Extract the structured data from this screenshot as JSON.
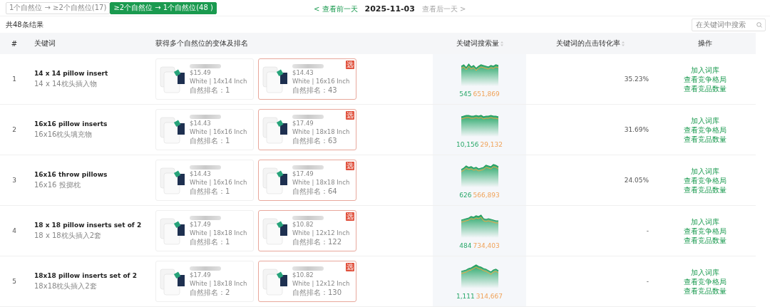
{
  "filter_tabs": [
    {
      "label": "1个自然位 → ≥2个自然位(17)",
      "selected": false
    },
    {
      "label": "≥2个自然位 → 1个自然位(48 )",
      "selected": true
    }
  ],
  "date_nav": {
    "prev": "< 查看前一天",
    "date": "2025-11-03",
    "next": "查看后一天 >",
    "next_disabled": true
  },
  "result_count": "共48条结果",
  "search": {
    "placeholder": "在关键词中搜索"
  },
  "table": {
    "columns": [
      {
        "label": "#",
        "sortable": false
      },
      {
        "label": "关键词",
        "sortable": false
      },
      {
        "label": "获得多个自然位的变体及排名",
        "sortable": false
      },
      {
        "label": "关键词搜索量",
        "sortable": true
      },
      {
        "label": "关键词的点击转化率",
        "sortable": true
      },
      {
        "label": "操作",
        "sortable": false
      }
    ],
    "rows": [
      {
        "index": "1",
        "keyword": "14 x 14 pillow insert",
        "translation": "14 x 14枕头插入物",
        "variants": [
          {
            "price": "$15.49",
            "spec": "White | 14x14 Inch",
            "rank": "自然排名：1",
            "flagged": false
          },
          {
            "price": "$14.43",
            "spec": "White | 16x16 Inch",
            "rank": "自然排名：43",
            "flagged": true,
            "badge": "选"
          }
        ],
        "primary": "545",
        "secondary": "651,869",
        "ctr": "35.23%",
        "actions": [
          "加入词库",
          "查看竞争格局",
          "查看竞品数量"
        ]
      },
      {
        "index": "2",
        "keyword": "16x16 pillow inserts",
        "translation": "16x16枕头填充物",
        "variants": [
          {
            "price": "$14.43",
            "spec": "White | 16x16 Inch",
            "rank": "自然排名：1",
            "flagged": false
          },
          {
            "price": "$17.49",
            "spec": "White | 18x18 Inch",
            "rank": "自然排名：63",
            "flagged": true,
            "badge": "选"
          }
        ],
        "primary": "10,156",
        "secondary": "29,132",
        "ctr": "31.69%",
        "actions": [
          "加入词库",
          "查看竞争格局",
          "查看竞品数量"
        ]
      },
      {
        "index": "3",
        "keyword": "16x16 throw pillows",
        "translation": "16x16 投掷枕",
        "variants": [
          {
            "price": "$14.43",
            "spec": "White | 16x16 Inch",
            "rank": "自然排名：1",
            "flagged": false
          },
          {
            "price": "$17.49",
            "spec": "White | 18x18 Inch",
            "rank": "自然排名：64",
            "flagged": true,
            "badge": "选"
          }
        ],
        "primary": "626",
        "secondary": "566,893",
        "ctr": "24.05%",
        "actions": [
          "加入词库",
          "查看竞争格局",
          "查看竞品数量"
        ]
      },
      {
        "index": "4",
        "keyword": "18 x 18 pillow inserts set of 2",
        "translation": "18 x 18枕头插入2套",
        "variants": [
          {
            "price": "$17.49",
            "spec": "White | 18x18 Inch",
            "rank": "自然排名：1",
            "flagged": false
          },
          {
            "price": "$10.82",
            "spec": "White | 12x12 Inch",
            "rank": "自然排名：122",
            "flagged": true,
            "badge": "选"
          }
        ],
        "primary": "484",
        "secondary": "734,403",
        "ctr": "-",
        "actions": [
          "加入词库",
          "查看竞争格局",
          "查看竞品数量"
        ]
      },
      {
        "index": "5",
        "keyword": "18x18 pillow inserts set of 2",
        "translation": "18x18枕头插入2套",
        "variants": [
          {
            "price": "$17.49",
            "spec": "White | 18x18 Inch",
            "rank": "自然排名：2",
            "flagged": false
          },
          {
            "price": "$10.82",
            "spec": "White | 12x12 Inch",
            "rank": "自然排名：130",
            "flagged": true,
            "badge": "选"
          }
        ],
        "primary": "1,111",
        "secondary": "314,667",
        "ctr": "-",
        "actions": [
          "加入词库",
          "查看竞争格局",
          "查看竞品数量"
        ]
      }
    ]
  }
}
